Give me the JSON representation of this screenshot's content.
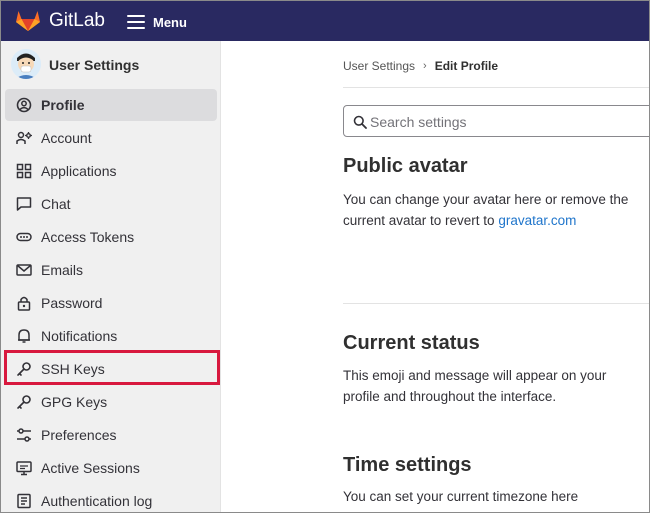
{
  "topbar": {
    "brand": "GitLab",
    "menu_label": "Menu"
  },
  "sidebar": {
    "title": "User Settings",
    "items": [
      {
        "label": "Profile",
        "icon": "profile-icon",
        "active": true
      },
      {
        "label": "Account",
        "icon": "account-icon"
      },
      {
        "label": "Applications",
        "icon": "applications-icon"
      },
      {
        "label": "Chat",
        "icon": "chat-icon"
      },
      {
        "label": "Access Tokens",
        "icon": "token-icon"
      },
      {
        "label": "Emails",
        "icon": "mail-icon"
      },
      {
        "label": "Password",
        "icon": "lock-icon"
      },
      {
        "label": "Notifications",
        "icon": "bell-icon"
      },
      {
        "label": "SSH Keys",
        "icon": "key-icon",
        "highlighted": true
      },
      {
        "label": "GPG Keys",
        "icon": "key-icon"
      },
      {
        "label": "Preferences",
        "icon": "preferences-icon"
      },
      {
        "label": "Active Sessions",
        "icon": "monitor-icon"
      },
      {
        "label": "Authentication log",
        "icon": "log-icon"
      }
    ]
  },
  "breadcrumb": {
    "parent": "User Settings",
    "separator": "›",
    "current": "Edit Profile"
  },
  "search": {
    "placeholder": "Search settings"
  },
  "sections": {
    "avatar": {
      "title": "Public avatar",
      "text": "You can change your avatar here or remove the current avatar to revert to ",
      "link": "gravatar.com"
    },
    "status": {
      "title": "Current status",
      "text": "This emoji and message will appear on your profile and throughout the interface."
    },
    "time": {
      "title": "Time settings",
      "text": "You can set your current timezone here"
    }
  },
  "colors": {
    "topbar": "#292961",
    "sidebar": "#f0f0f0",
    "active_item": "#dcdcde",
    "highlight_box": "#d8183e",
    "link": "#1f75cb",
    "logo_orange": "#fc6d26"
  }
}
